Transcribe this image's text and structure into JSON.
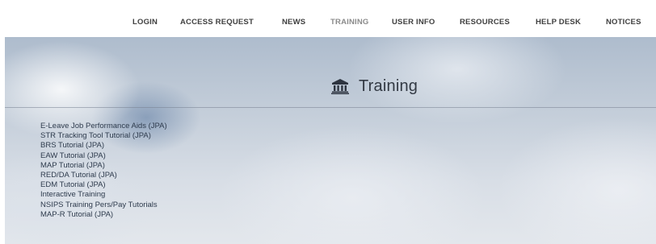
{
  "nav": {
    "items": [
      {
        "label": "LOGIN",
        "active": false
      },
      {
        "label": "ACCESS REQUEST",
        "active": false
      },
      {
        "label": "NEWS",
        "active": false
      },
      {
        "label": "TRAINING",
        "active": true
      },
      {
        "label": "USER INFO",
        "active": false
      },
      {
        "label": "RESOURCES",
        "active": false
      },
      {
        "label": "HELP DESK",
        "active": false
      },
      {
        "label": "NOTICES",
        "active": false
      }
    ]
  },
  "page": {
    "title": "Training",
    "title_icon": "bank-building-icon"
  },
  "training_links": [
    "E-Leave Job Performance Aids (JPA)",
    "STR Tracking Tool Tutorial (JPA)",
    "BRS Tutorial (JPA)",
    "EAW Tutorial (JPA)",
    "MAP Tutorial (JPA)",
    "RED/DA Tutorial (JPA)",
    "EDM Tutorial (JPA)",
    "Interactive Training",
    "NSIPS Training Pers/Pay Tutorials",
    "MAP-R Tutorial (JPA)"
  ],
  "colors": {
    "nav_text": "#3f3f3f",
    "nav_active": "#8a8a8a",
    "link_text": "#2e3b4d",
    "title_text": "#333a44"
  }
}
